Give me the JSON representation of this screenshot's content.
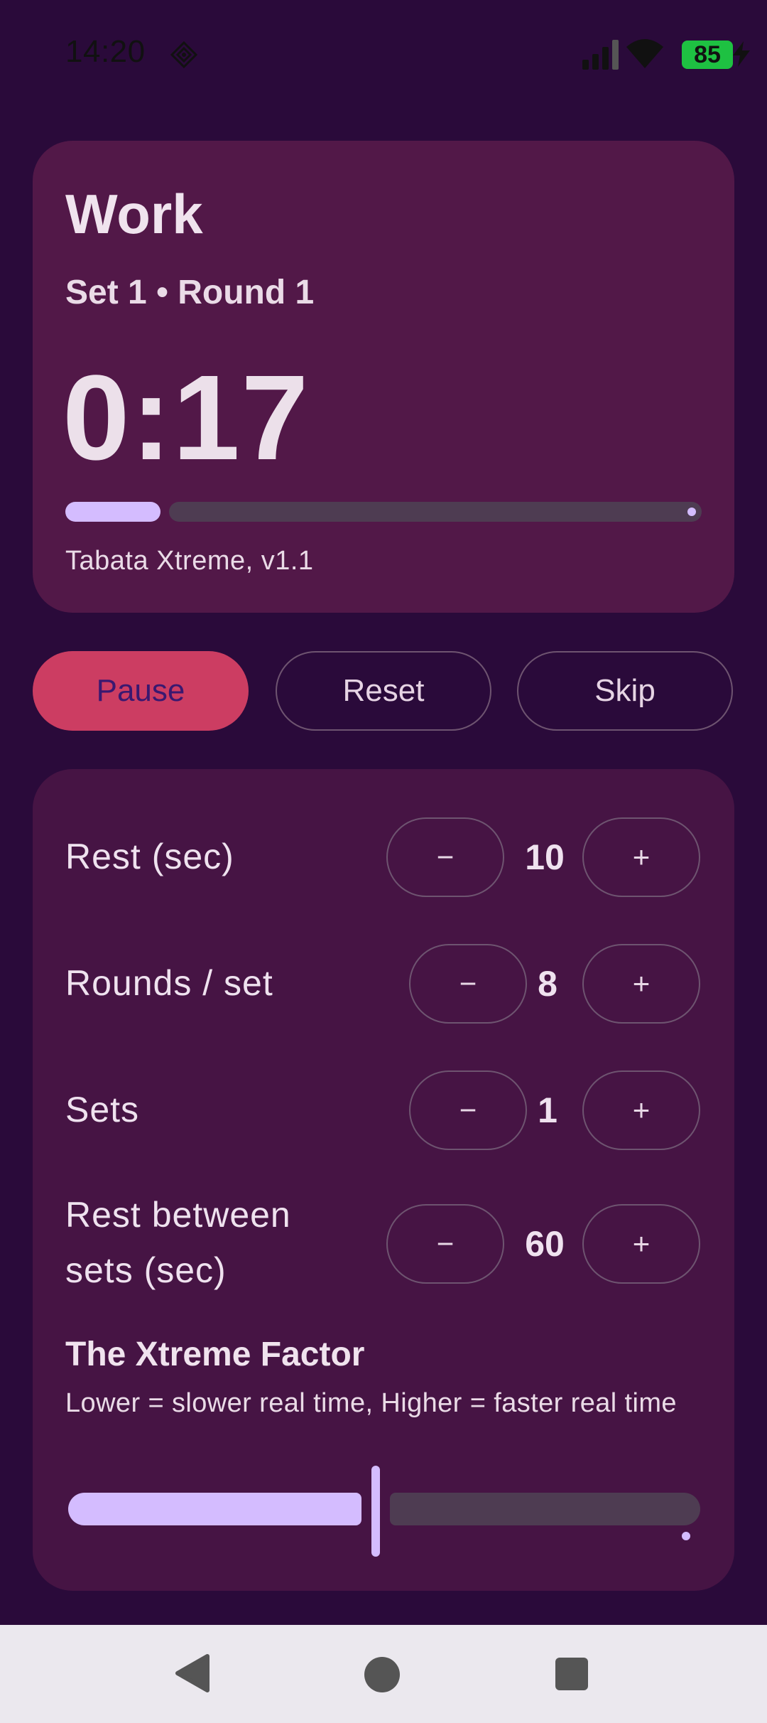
{
  "status_bar": {
    "time": "14:20",
    "battery_level": "85",
    "icons": [
      "diamond-icon",
      "signal-icon",
      "wifi-icon",
      "battery-icon",
      "charging-bolt-icon"
    ]
  },
  "timer": {
    "phase": "Work",
    "set_round": "Set 1 • Round 1",
    "time_remaining": "0:17",
    "progress_fraction": 0.15,
    "preset_name": "Tabata Xtreme, v1.1"
  },
  "controls": {
    "pause_label": "Pause",
    "reset_label": "Reset",
    "skip_label": "Skip"
  },
  "settings": [
    {
      "label_lines": [
        "Rest (sec)"
      ],
      "value": "10",
      "minus": "−",
      "plus": "+"
    },
    {
      "label_lines": [
        "Rounds / set"
      ],
      "value": "8",
      "minus": "−",
      "plus": "+"
    },
    {
      "label_lines": [
        "Sets"
      ],
      "value": "1",
      "minus": "−",
      "plus": "+"
    },
    {
      "label_lines": [
        "Rest between",
        "sets (sec)"
      ],
      "value": "60",
      "minus": "−",
      "plus": "+"
    }
  ],
  "xtreme_factor": {
    "title": "The Xtreme Factor",
    "description": "Lower = slower real time, Higher = faster real time",
    "slider_fraction": 0.48
  },
  "colors": {
    "background": "#2a0a3a",
    "card": "#521848",
    "accent": "#d4bcff",
    "pause": "#cc3d62"
  },
  "nav": {
    "icons": [
      "back-icon",
      "home-icon",
      "recents-icon"
    ]
  }
}
